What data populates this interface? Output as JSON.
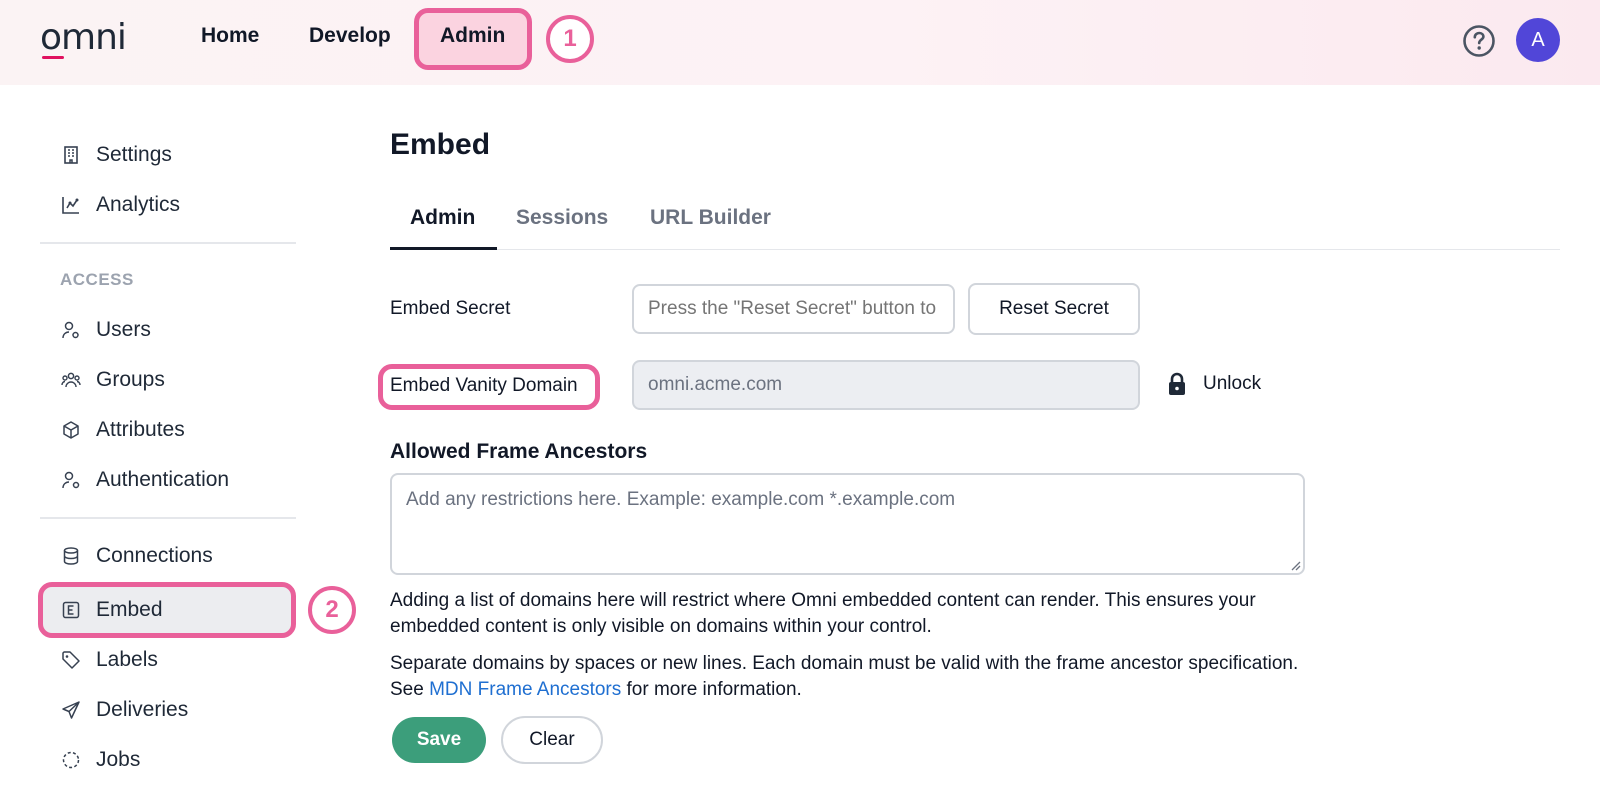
{
  "brand": {
    "logo_text": "omni",
    "accent": "#e0115f"
  },
  "topnav": {
    "items": [
      {
        "label": "Home"
      },
      {
        "label": "Develop"
      },
      {
        "label": "Admin"
      }
    ],
    "avatar_initial": "A",
    "highlight_color": "#e9609a"
  },
  "callouts": {
    "one": "1",
    "two": "2"
  },
  "sidebar": {
    "top_items": [
      {
        "label": "Settings",
        "icon": "building-icon"
      },
      {
        "label": "Analytics",
        "icon": "chart-icon"
      }
    ],
    "access_heading": "ACCESS",
    "access_items": [
      {
        "label": "Users",
        "icon": "user-gear-icon"
      },
      {
        "label": "Groups",
        "icon": "group-icon"
      },
      {
        "label": "Attributes",
        "icon": "cube-icon"
      },
      {
        "label": "Authentication",
        "icon": "user-key-icon"
      }
    ],
    "bottom_items": [
      {
        "label": "Connections",
        "icon": "database-icon"
      },
      {
        "label": "Embed",
        "icon": "embed-icon"
      },
      {
        "label": "Labels",
        "icon": "tag-icon"
      },
      {
        "label": "Deliveries",
        "icon": "send-icon"
      },
      {
        "label": "Jobs",
        "icon": "dashed-circle-icon"
      }
    ]
  },
  "main": {
    "title": "Embed",
    "tabs": [
      {
        "label": "Admin",
        "active": true
      },
      {
        "label": "Sessions",
        "active": false
      },
      {
        "label": "URL Builder",
        "active": false
      }
    ],
    "embed_secret": {
      "label": "Embed Secret",
      "placeholder": "Press the \"Reset Secret\" button to generate a secret",
      "reset_label": "Reset Secret"
    },
    "vanity_domain": {
      "label": "Embed Vanity Domain",
      "value": "omni.acme.com",
      "unlock_label": "Unlock"
    },
    "frame_ancestors": {
      "title": "Allowed Frame Ancestors",
      "placeholder": "Add any restrictions here. Example: example.com *.example.com",
      "help1": "Adding a list of domains here will restrict where Omni embedded content can render. This ensures your embedded content is only visible on domains within your control.",
      "help2_before": "Separate domains by spaces or new lines. Each domain must be valid with the frame ancestor specification. See ",
      "help2_link": "MDN Frame Ancestors",
      "help2_after": " for more information."
    },
    "save_label": "Save",
    "clear_label": "Clear",
    "save_color": "#3c9e7b",
    "link_color": "#1f6fd1"
  }
}
